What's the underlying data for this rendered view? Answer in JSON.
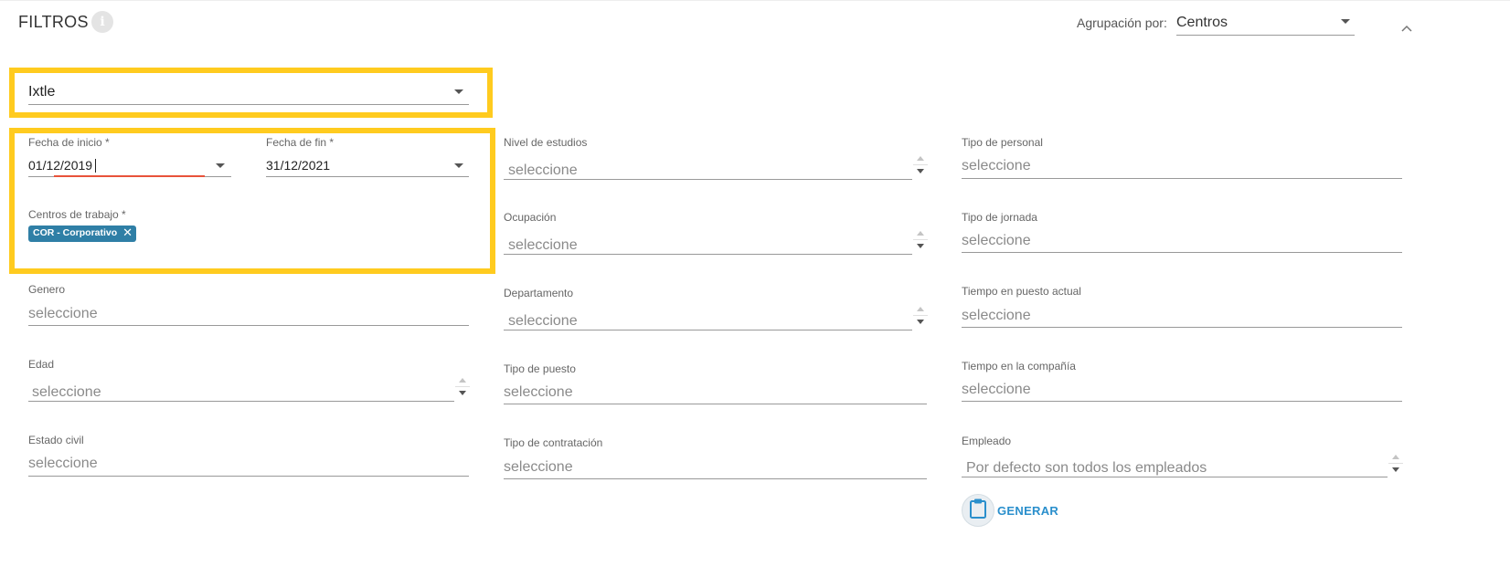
{
  "header": {
    "title": "FILTROS",
    "info_icon": "info-icon",
    "grouping_label": "Agrupación por:",
    "grouping_value": "Centros",
    "collapse_icon": "chevron-up-icon"
  },
  "company_select": {
    "value": "Ixtle"
  },
  "dates": {
    "start_label": "Fecha de inicio *",
    "start_value": "01/12/2019",
    "end_label": "Fecha de fin *",
    "end_value": "31/12/2021"
  },
  "work_centers": {
    "label": "Centros de trabajo *",
    "chip": "COR - Corporativo",
    "chip_remove": "✕"
  },
  "left_fields": {
    "genero_label": "Genero",
    "genero_ph": "seleccione",
    "edad_label": "Edad",
    "edad_ph": "seleccione",
    "estado_civil_label": "Estado civil",
    "estado_civil_ph": "seleccione"
  },
  "middle_fields": {
    "nivel_label": "Nivel de estudios",
    "nivel_ph": "seleccione",
    "ocupacion_label": "Ocupación",
    "ocupacion_ph": "seleccione",
    "departamento_label": "Departamento",
    "departamento_ph": "seleccione",
    "tipo_puesto_label": "Tipo de puesto",
    "tipo_puesto_ph": "seleccione",
    "tipo_contratacion_label": "Tipo de contratación",
    "tipo_contratacion_ph": "seleccione"
  },
  "right_fields": {
    "tipo_personal_label": "Tipo de personal",
    "tipo_personal_ph": "seleccione",
    "tipo_jornada_label": "Tipo de jornada",
    "tipo_jornada_ph": "seleccione",
    "tiempo_puesto_label": "Tiempo en puesto actual",
    "tiempo_puesto_ph": "seleccione",
    "tiempo_compania_label": "Tiempo en la compañía",
    "tiempo_compania_ph": "seleccione",
    "empleado_label": "Empleado",
    "empleado_ph": "Por defecto son todos los empleados"
  },
  "actions": {
    "generate_label": "GENERAR",
    "generate_icon": "clipboard-icon"
  },
  "colors": {
    "highlight": "#ffcb1f",
    "chip": "#2f7fa6",
    "accent": "#2a8fcc",
    "error_underline": "#e8533a"
  }
}
